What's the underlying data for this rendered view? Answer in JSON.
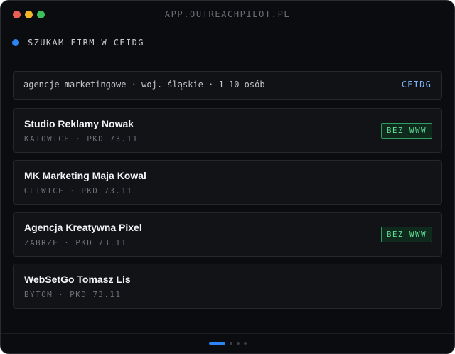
{
  "window": {
    "title": "APP.OUTREACHPILOT.PL"
  },
  "status": {
    "text": "SZUKAM FIRM W CEIDG",
    "color": "#2b86f3"
  },
  "query": {
    "text": "agencje marketingowe · woj. śląskie · 1-10 osób",
    "source": "CEIDG"
  },
  "results": [
    {
      "name": "Studio Reklamy Nowak",
      "meta": "KATOWICE · PKD 73.11",
      "badge": "BEZ WWW"
    },
    {
      "name": "MK Marketing Maja Kowal",
      "meta": "GLIWICE · PKD 73.11",
      "badge": ""
    },
    {
      "name": "Agencja Kreatywna Pixel",
      "meta": "ZABRZE · PKD 73.11",
      "badge": "BEZ WWW"
    },
    {
      "name": "WebSetGo Tomasz Lis",
      "meta": "BYTOM · PKD 73.11",
      "badge": ""
    }
  ],
  "pager": {
    "pages": 4,
    "current": 1
  },
  "colors": {
    "background": "#0b0c0f",
    "accent": "#2b86f3",
    "badge_text": "#5fdc95",
    "badge_border": "#2f9c62"
  }
}
